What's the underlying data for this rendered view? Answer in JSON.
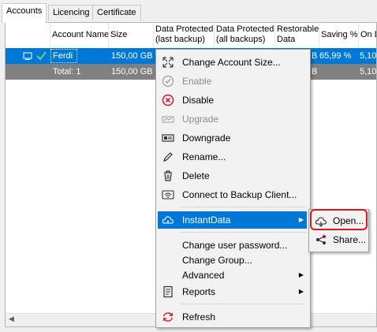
{
  "tabs": [
    {
      "label": "Accounts",
      "active": true
    },
    {
      "label": "Licencing",
      "active": false
    },
    {
      "label": "Certificate",
      "active": false
    }
  ],
  "table": {
    "columns": [
      "Account Name",
      "Size",
      "Data Protected\n(last backup)",
      "Data Protected\n(all backups)",
      "Restorable\nData",
      "Saving %",
      "On D"
    ],
    "selected_row": {
      "account_name": "Ferdi",
      "size": "150,00 GB",
      "restorable_tail": "B",
      "saving": "65,99 %",
      "on_d": "5,10"
    },
    "total_row": {
      "label": "Total: 1",
      "size": "150,00 GB",
      "restorable_tail": "B",
      "on_d": "5,10"
    }
  },
  "context_menu": {
    "items": [
      {
        "id": "change-size",
        "label": "Change Account Size...",
        "icon": "resize-arrows-icon",
        "disabled": false
      },
      {
        "id": "enable",
        "label": "Enable",
        "icon": "check-circle-icon",
        "disabled": true
      },
      {
        "id": "disable",
        "label": "Disable",
        "icon": "x-circle-icon",
        "disabled": false
      },
      {
        "id": "upgrade",
        "label": "Upgrade",
        "icon": "upgrade-card-icon",
        "disabled": true
      },
      {
        "id": "downgrade",
        "label": "Downgrade",
        "icon": "downgrade-card-icon",
        "disabled": false
      },
      {
        "id": "rename",
        "label": "Rename...",
        "icon": "pencil-icon",
        "disabled": false
      },
      {
        "id": "delete",
        "label": "Delete",
        "icon": "trash-icon",
        "disabled": false
      },
      {
        "id": "connect",
        "label": "Connect to Backup Client...",
        "icon": "wifi-device-icon",
        "disabled": false
      },
      {
        "id": "instantdata",
        "label": "InstantData",
        "icon": "cloud-icon",
        "highlighted": true,
        "submenu": true
      },
      {
        "id": "change-password",
        "label": "Change user password...",
        "disabled": false
      },
      {
        "id": "change-group",
        "label": "Change Group...",
        "disabled": false
      },
      {
        "id": "advanced",
        "label": "Advanced",
        "submenu": true
      },
      {
        "id": "reports",
        "label": "Reports",
        "icon": "report-icon",
        "submenu": true
      },
      {
        "id": "refresh",
        "label": "Refresh",
        "icon": "refresh-icon",
        "disabled": false
      }
    ]
  },
  "submenu": {
    "items": [
      {
        "id": "open",
        "label": "Open...",
        "icon": "cloud-open-icon"
      },
      {
        "id": "share",
        "label": "Share...",
        "icon": "share-icon"
      }
    ]
  },
  "colors": {
    "selection": "#0078d7",
    "total_row": "#808080",
    "annotation_box": "#e0141e"
  }
}
